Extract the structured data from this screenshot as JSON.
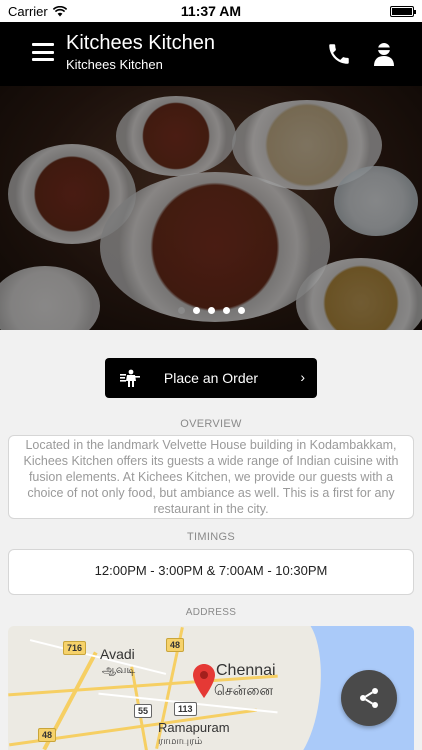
{
  "status_bar": {
    "carrier": "Carrier",
    "time": "11:37 AM"
  },
  "header": {
    "title": "Kitchees Kitchen",
    "subtitle": "Kitchees Kitchen",
    "icons": [
      "menu-icon",
      "phone-icon",
      "user-icon"
    ]
  },
  "carousel": {
    "slide_count": 5,
    "active_index": 0
  },
  "order_button": {
    "label": "Place an Order",
    "chevron": "›",
    "icon": "waiter-icon"
  },
  "overview": {
    "label": "OVERVIEW",
    "text": "Located in the landmark Velvette House building in Kodambakkam, Kichees Kitchen offers its guests a wide range of Indian cuisine with fusion elements. At Kichees Kitchen, we provide our guests with a choice of not only food, but ambiance as well. This is a first for any restaurant in the city."
  },
  "timings": {
    "label": "TIMINGS",
    "text": "12:00PM - 3:00PM & 7:00AM - 10:30PM"
  },
  "address": {
    "label": "ADDRESS"
  },
  "map": {
    "places": {
      "avadi": "Avadi",
      "avadi_tamil": "ஆவடி",
      "chennai": "Chennai",
      "chennai_tamil": "சென்னை",
      "ramapuram": "Ramapuram",
      "ramapuram_tamil": "ராமாபுரம்"
    },
    "road_shields": {
      "r716": "716",
      "r48_top": "48",
      "r55": "55",
      "r113": "113",
      "r48_bottom": "48"
    },
    "colors": {
      "land": "#eceae3",
      "water": "#aacaf9",
      "pin": "#e53935"
    }
  },
  "share_button": {
    "icon": "share-icon"
  },
  "colors": {
    "header_bg": "#000000",
    "page_bg": "#f1f1f1",
    "card_bg": "#ffffff",
    "muted_text": "#9a9a9a"
  }
}
